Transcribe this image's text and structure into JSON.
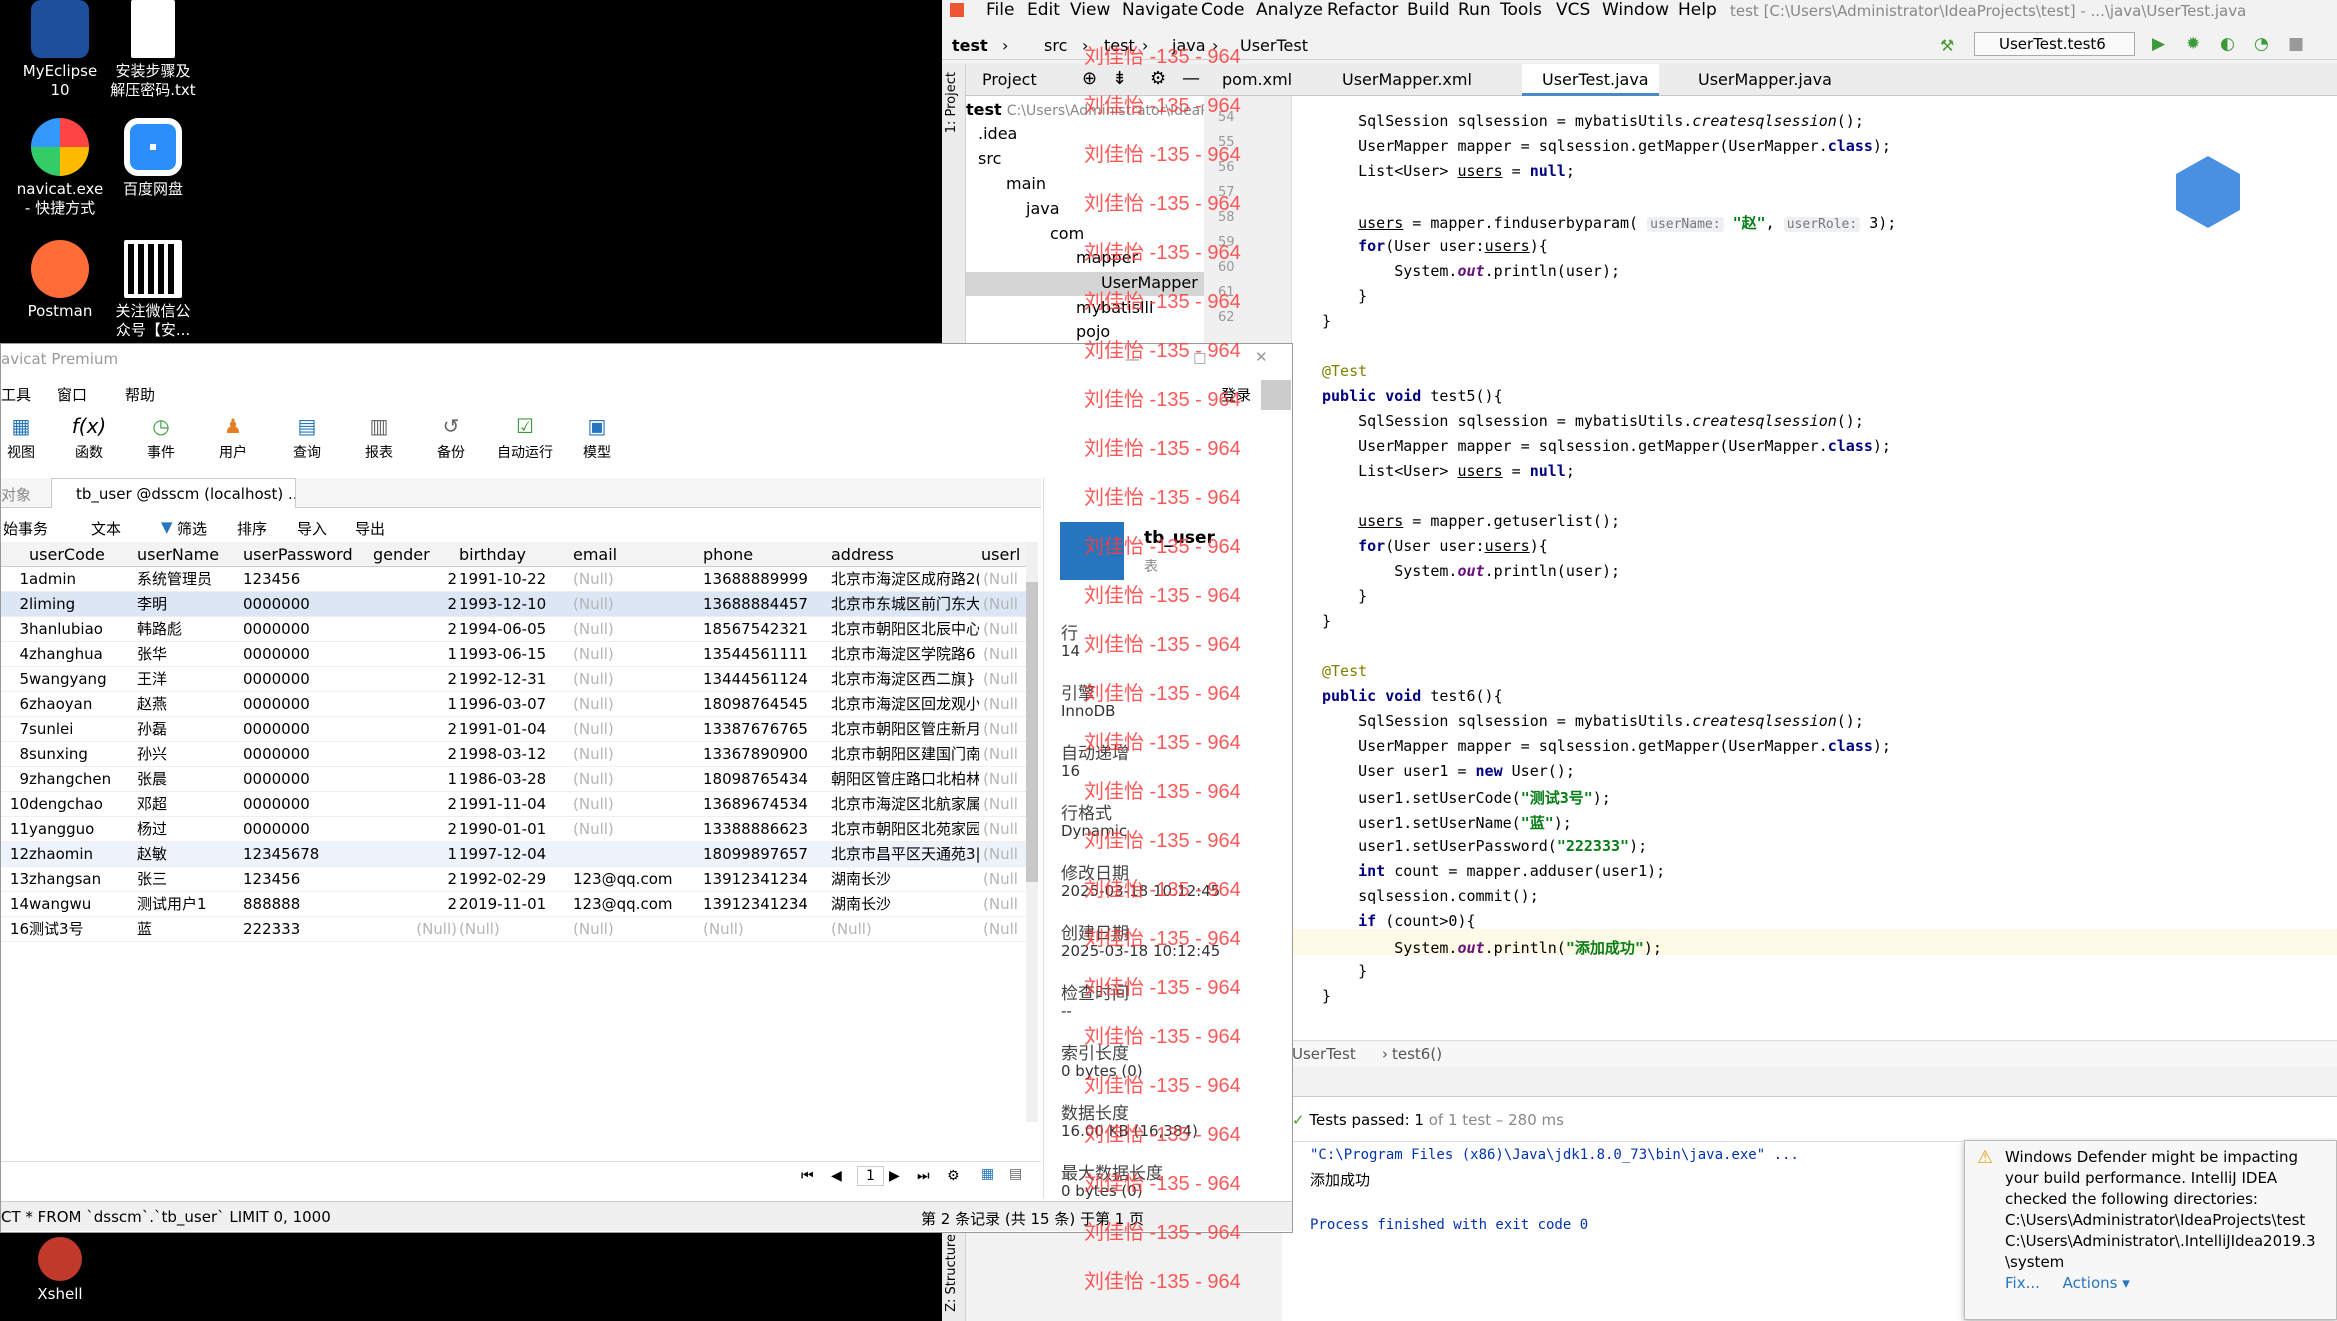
{
  "desktop": {
    "icons": [
      {
        "label": "MyEclipse\n10"
      },
      {
        "label": "安装步骤及\n解压密码.txt"
      },
      {
        "label": "navicat.exe\n- 快捷方式"
      },
      {
        "label": "百度网盘"
      },
      {
        "label": "Postman"
      },
      {
        "label": "关注微信公\n众号【安..."
      },
      {
        "label": "Xshell"
      }
    ]
  },
  "ide": {
    "menu": [
      "File",
      "Edit",
      "View",
      "Navigate",
      "Code",
      "Analyze",
      "Refactor",
      "Build",
      "Run",
      "Tools",
      "VCS",
      "Window",
      "Help"
    ],
    "title": "test [C:\\Users\\Administrator\\IdeaProjects\\test] - ...\\java\\UserTest.java",
    "breadcrumbs": [
      "test",
      "src",
      "test",
      "java",
      "UserTest"
    ],
    "run_config": "UserTest.test6",
    "project_tab": "Project",
    "editor_tabs": [
      "pom.xml",
      "UserMapper.xml",
      "UserTest.java",
      "UserMapper.java"
    ],
    "tree": [
      {
        "label": "test",
        "path": "C:\\Users\\Administrator\\IdeaP"
      },
      {
        "label": ".idea"
      },
      {
        "label": "src"
      },
      {
        "label": "main"
      },
      {
        "label": "java"
      },
      {
        "label": "com"
      },
      {
        "label": "mapper"
      },
      {
        "label": "UserMapper"
      },
      {
        "label": "mybatislll"
      },
      {
        "label": "pojo"
      }
    ],
    "line_numbers": [
      "54",
      "55",
      "56",
      "57",
      "58",
      "59",
      "60",
      "61",
      "62"
    ],
    "breadcrumb_bottom": [
      "UserTest",
      "test6()"
    ],
    "tests_passed": "Tests passed: 1",
    "tests_detail": "of 1 test – 280 ms",
    "console": [
      "\"C:\\Program Files (x86)\\Java\\jdk1.8.0_73\\bin\\java.exe\" ...",
      "添加成功",
      "Process finished with exit code 0"
    ],
    "notification": {
      "text": "Windows Defender might be impacting your build performance. IntelliJ IDEA checked the following directories:",
      "dir1": "C:\\Users\\Administrator\\IdeaProjects\\test",
      "dir2": "C:\\Users\\Administrator\\.IntelliJIdea2019.3\\system",
      "fix": "Fix...",
      "actions": "Actions ▾"
    },
    "side_labels": {
      "project": "1: Project",
      "structure": "Z: Structure"
    }
  },
  "watermark": "刘佳怡 -135 - 964",
  "navicat": {
    "title": "avicat Premium",
    "menu": [
      "工具",
      "窗口",
      "帮助"
    ],
    "toolbar": [
      "视图",
      "函数",
      "事件",
      "用户",
      "查询",
      "报表",
      "备份",
      "自动运行",
      "模型"
    ],
    "login": "登录",
    "object_tab": "对象",
    "table_tab": "tb_user @dsscm (localhost) ...",
    "actions": [
      "始事务",
      "文本",
      "筛选",
      "排序",
      "导入",
      "导出"
    ],
    "columns": [
      "userCode",
      "userName",
      "userPassword",
      "gender",
      "birthday",
      "email",
      "phone",
      "address",
      "userl"
    ],
    "rows": [
      [
        "1",
        "admin",
        "系统管理员",
        "123456",
        "2",
        "1991-10-22",
        "(Null)",
        "13688889999",
        "北京市海淀区成府路2("
      ],
      [
        "2",
        "liming",
        "李明",
        "0000000",
        "2",
        "1993-12-10",
        "(Null)",
        "13688884457",
        "北京市东城区前门东大"
      ],
      [
        "3",
        "hanlubiao",
        "韩路彪",
        "0000000",
        "2",
        "1994-06-05",
        "(Null)",
        "18567542321",
        "北京市朝阳区北辰中心"
      ],
      [
        "4",
        "zhanghua",
        "张华",
        "0000000",
        "1",
        "1993-06-15",
        "(Null)",
        "13544561111",
        "北京市海淀区学院路6"
      ],
      [
        "5",
        "wangyang",
        "王洋",
        "0000000",
        "2",
        "1992-12-31",
        "(Null)",
        "13444561124",
        "北京市海淀区西二旗}"
      ],
      [
        "6",
        "zhaoyan",
        "赵燕",
        "0000000",
        "1",
        "1996-03-07",
        "(Null)",
        "18098764545",
        "北京市海淀区回龙观小"
      ],
      [
        "7",
        "sunlei",
        "孙磊",
        "0000000",
        "2",
        "1991-01-04",
        "(Null)",
        "13387676765",
        "北京市朝阳区管庄新月"
      ],
      [
        "8",
        "sunxing",
        "孙兴",
        "0000000",
        "2",
        "1998-03-12",
        "(Null)",
        "13367890900",
        "北京市朝阳区建国门南"
      ],
      [
        "9",
        "zhangchen",
        "张晨",
        "0000000",
        "1",
        "1986-03-28",
        "(Null)",
        "18098765434",
        "朝阳区管庄路口北柏林"
      ],
      [
        "10",
        "dengchao",
        "邓超",
        "0000000",
        "2",
        "1991-11-04",
        "(Null)",
        "13689674534",
        "北京市海淀区北航家属"
      ],
      [
        "11",
        "yangguo",
        "杨过",
        "0000000",
        "2",
        "1990-01-01",
        "(Null)",
        "13388886623",
        "北京市朝阳区北苑家园"
      ],
      [
        "12",
        "zhaomin",
        "赵敏",
        "12345678",
        "1",
        "1997-12-04",
        "",
        "18099897657",
        "北京市昌平区天通苑3|"
      ],
      [
        "13",
        "zhangsan",
        "张三",
        "123456",
        "2",
        "1992-02-29",
        "123@qq.com",
        "13912341234",
        "湖南长沙"
      ],
      [
        "14",
        "wangwu",
        "测试用户1",
        "888888",
        "2",
        "2019-11-01",
        "123@qq.com",
        "13912341234",
        "湖南长沙"
      ],
      [
        "16",
        "测试3号",
        "蓝",
        "222333",
        "(Null)",
        "(Null)",
        "(Null)",
        "(Null)",
        "(Null)"
      ]
    ],
    "last_col": "(Null",
    "page": "1",
    "sql": "CT * FROM `dsscm`.`tb_user` LIMIT 0, 1000",
    "status": "第 2 条记录 (共 15 条) 于第 1 页",
    "side": {
      "name": "tb_user",
      "type": "表",
      "items": [
        [
          "行",
          "14"
        ],
        [
          "引擎",
          "InnoDB"
        ],
        [
          "自动递增",
          "16"
        ],
        [
          "行格式",
          "Dynamic"
        ],
        [
          "修改日期",
          "2025-03-18 10:12:45"
        ],
        [
          "创建日期",
          "2025-03-18 10:12:45"
        ],
        [
          "检查时间",
          "--"
        ],
        [
          "索引长度",
          "0 bytes (0)"
        ],
        [
          "数据长度",
          "16.00 KB (16,384)"
        ],
        [
          "最大数据长度",
          "0 bytes (0)"
        ]
      ]
    }
  },
  "colors": {
    "accent": "#2675bf",
    "ide_bg": "#f2f2f2",
    "watermark": "#ff3b3b",
    "selected_row": "#dce6f5"
  }
}
